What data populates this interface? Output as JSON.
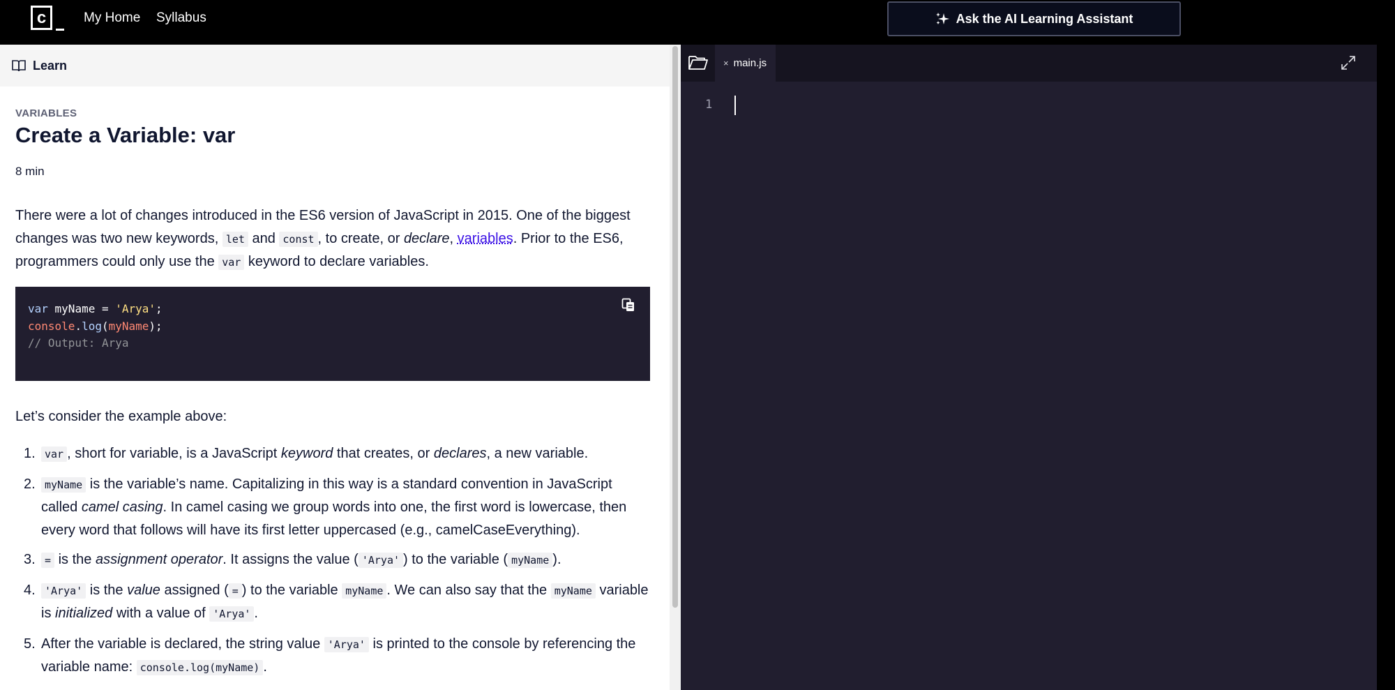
{
  "nav": {
    "home": "My Home",
    "syllabus": "Syllabus",
    "ai_button": "Ask the AI Learning Assistant"
  },
  "learn_panel": {
    "header": "Learn",
    "eyebrow": "VARIABLES",
    "title": "Create a Variable: var",
    "duration": "8 min",
    "intro": {
      "p1": "There were a lot of changes introduced in the ES6 version of JavaScript in 2015. One of the biggest changes was two new keywords, ",
      "code_let": "let",
      "and": " and ",
      "code_const": "const",
      "p2": ", to create, or ",
      "declare": "declare",
      "comma": ", ",
      "link": "variables",
      "p3": ". Prior to the ES6, programmers could only use the ",
      "code_var": "var",
      "p4": " keyword to declare variables."
    },
    "code_example": {
      "line1_kw": "var",
      "line1_rest": " myName = ",
      "line1_str": "'Arya'",
      "line1_end": ";",
      "line2_obj": "console",
      "line2_dot": ".",
      "line2_fn": "log",
      "line2_open": "(",
      "line2_arg": "myName",
      "line2_close": ");",
      "line3_comment": "// Output: Arya"
    },
    "consider": "Let’s consider the example above:",
    "steps": [
      {
        "num": "1.",
        "code": "var",
        "t1": ", short for variable, is a JavaScript ",
        "em1": "keyword",
        "t2": " that creates, or ",
        "em2": "declares",
        "t3": ", a new variable."
      },
      {
        "num": "2.",
        "code": "myName",
        "t1": " is the variable’s name. Capitalizing in this way is a standard convention in JavaScript called ",
        "em1": "camel casing",
        "t2": ". In camel casing we group words into one, the first word is lowercase, then every word that follows will have its first letter uppercased (e.g., camelCaseEverything)."
      },
      {
        "num": "3.",
        "code": "=",
        "t1": " is the ",
        "em1": "assignment operator",
        "t2": ". It assigns the value (",
        "code2": "'Arya'",
        "t3": ") to the variable (",
        "code3": "myName",
        "t4": ")."
      },
      {
        "num": "4.",
        "code": "'Arya'",
        "t1": " is the ",
        "em1": "value",
        "t2": " assigned (",
        "code2": "=",
        "t3": ") to the variable ",
        "code3": "myName",
        "t4": ". We can also say that the ",
        "code4": "myName",
        "t5": " variable is ",
        "em2": "initialized",
        "t6": " with a value of ",
        "code5": "'Arya'",
        "t7": "."
      },
      {
        "num": "5.",
        "t1": "After the variable is declared, the string value ",
        "code": "'Arya'",
        "t2": " is printed to the console by referencing the variable name: ",
        "code2": "console.log(myName)",
        "t3": "."
      }
    ]
  },
  "editor": {
    "tab_filename": "main.js",
    "tab_close": "×",
    "line_number": "1"
  }
}
